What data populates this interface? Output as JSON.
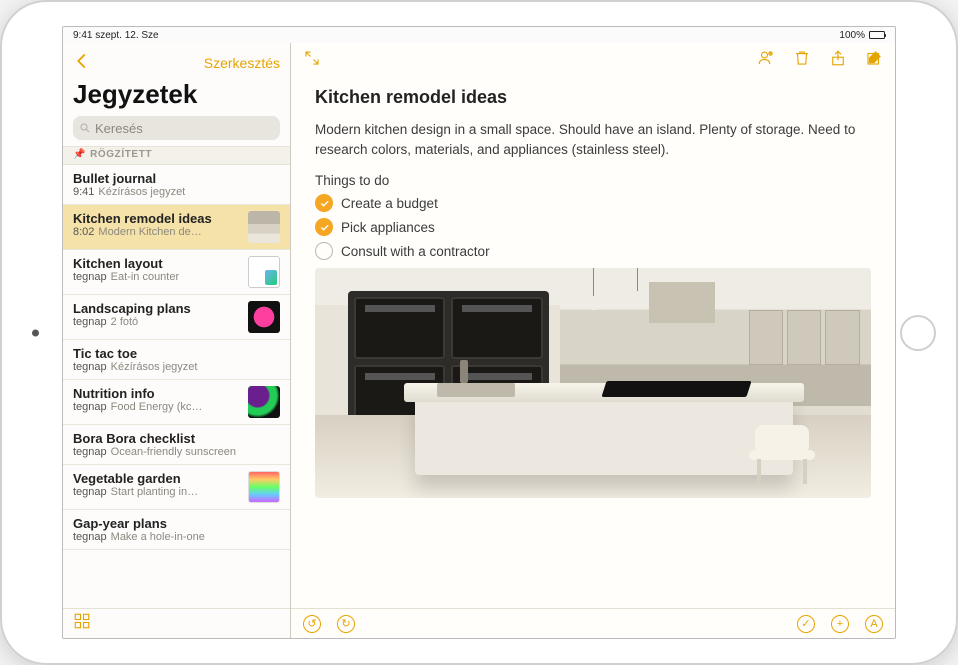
{
  "status": {
    "time_date": "9:41  szept. 12. Sze",
    "battery_pct": "100%"
  },
  "sidebar": {
    "edit": "Szerkesztés",
    "title": "Jegyzetek",
    "search_placeholder": "Keresés",
    "pinned_label": "RÖGZÍTETT",
    "notes": [
      {
        "title": "Bullet journal",
        "time": "9:41",
        "preview": "Kézírásos jegyzet",
        "thumb": "",
        "selected": false
      },
      {
        "title": "Kitchen remodel ideas",
        "time": "8:02",
        "preview": "Modern Kitchen de…",
        "thumb": "kitchen",
        "selected": true
      },
      {
        "title": "Kitchen layout",
        "time": "tegnap",
        "preview": "Eat-in counter",
        "thumb": "layout",
        "selected": false
      },
      {
        "title": "Landscaping plans",
        "time": "tegnap",
        "preview": "2 fotó",
        "thumb": "flower",
        "selected": false
      },
      {
        "title": "Tic tac toe",
        "time": "tegnap",
        "preview": "Kézírásos jegyzet",
        "thumb": "",
        "selected": false
      },
      {
        "title": "Nutrition info",
        "time": "tegnap",
        "preview": "Food Energy (kc…",
        "thumb": "veggies",
        "selected": false
      },
      {
        "title": "Bora Bora checklist",
        "time": "tegnap",
        "preview": "Ocean-friendly sunscreen",
        "thumb": "",
        "selected": false
      },
      {
        "title": "Vegetable garden",
        "time": "tegnap",
        "preview": "Start planting in…",
        "thumb": "rainbow",
        "selected": false
      },
      {
        "title": "Gap-year plans",
        "time": "tegnap",
        "preview": "Make a hole-in-one",
        "thumb": "",
        "selected": false
      }
    ]
  },
  "toolbar_icons": {
    "expand": "expand",
    "collaborate": "collaborate",
    "trash": "trash",
    "share": "share",
    "compose": "compose"
  },
  "note": {
    "title": "Kitchen remodel ideas",
    "body": "Modern kitchen design in a small space. Should have an island. Plenty of storage. Need to research colors, materials, and appliances (stainless steel).",
    "subhead": "Things to do",
    "checklist": [
      {
        "label": "Create a budget",
        "checked": true
      },
      {
        "label": "Pick appliances",
        "checked": true
      },
      {
        "label": "Consult with a contractor",
        "checked": false
      }
    ]
  },
  "footer_icons": {
    "undo": "↺",
    "redo": "↻",
    "check": "✓",
    "plus": "+",
    "pencil": "A"
  }
}
